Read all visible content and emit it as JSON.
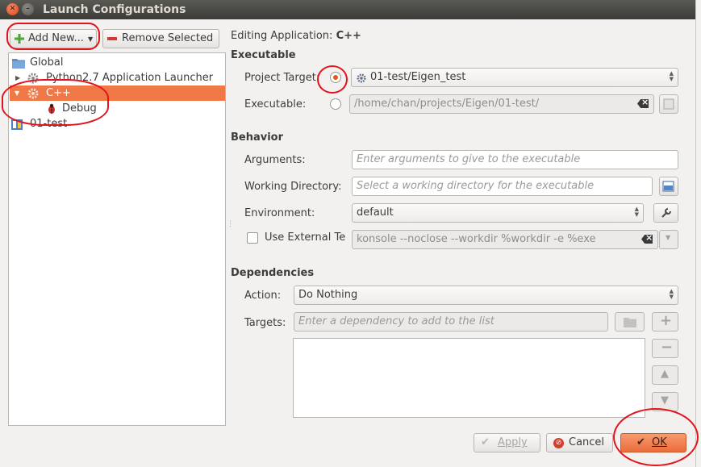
{
  "window": {
    "title": "Launch Configurations"
  },
  "toolbar": {
    "add_new": "Add New...",
    "remove_selected": "Remove Selected"
  },
  "tree": {
    "items": [
      {
        "label": "Global"
      },
      {
        "label": "Python2.7 Application Launcher"
      },
      {
        "label": "C++"
      },
      {
        "label": "Debug"
      },
      {
        "label": "01-test"
      }
    ]
  },
  "editing": {
    "prefix": "Editing Application:",
    "name": "C++"
  },
  "executable_section": {
    "header": "Executable",
    "project_target_label": "Project Target:",
    "project_target_value": "01-test/Eigen_test",
    "executable_label": "Executable:",
    "executable_value": "/home/chan/projects/Eigen/01-test/"
  },
  "behavior_section": {
    "header": "Behavior",
    "arguments_label": "Arguments:",
    "arguments_placeholder": "Enter arguments to give to the executable",
    "workdir_label": "Working Directory:",
    "workdir_placeholder": "Select a working directory for the executable",
    "environment_label": "Environment:",
    "environment_value": "default",
    "external_terminal_label": "Use External Te",
    "external_terminal_value": "konsole --noclose --workdir %workdir -e %exe"
  },
  "dependencies_section": {
    "header": "Dependencies",
    "action_label": "Action:",
    "action_value": "Do Nothing",
    "targets_label": "Targets:",
    "targets_placeholder": "Enter a dependency to add to the list"
  },
  "footer": {
    "apply": "Apply",
    "cancel": "Cancel",
    "ok": "OK"
  },
  "colors": {
    "selection": "#f07746",
    "annotation_red": "#e3131b"
  }
}
